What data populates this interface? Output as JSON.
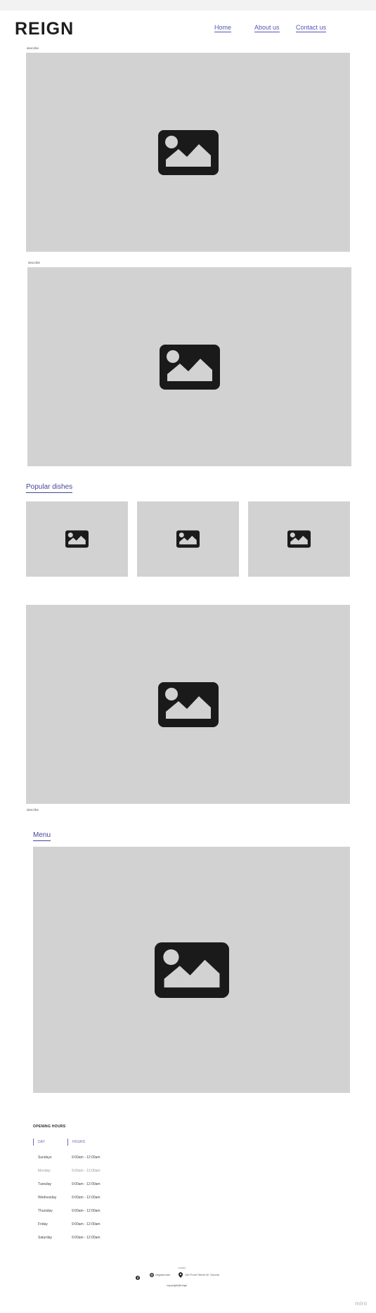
{
  "header": {
    "logo": "REIGN",
    "nav": {
      "home": "Home",
      "about": "About us",
      "contact": "Contact us"
    }
  },
  "captions": {
    "first": "describe",
    "second": "describe",
    "third": "describe"
  },
  "popular": {
    "title": "Popular dishes"
  },
  "menu": {
    "title": "Menu"
  },
  "hours": {
    "title": "OPENING HOURS",
    "col_day": "DAY",
    "col_hours": "HOURS",
    "rows": [
      {
        "day": "Sundays",
        "hours": "9:00am - 12:00am"
      },
      {
        "day": "Monday",
        "hours": "9:00am - 12:00am"
      },
      {
        "day": "Tuesday",
        "hours": "9:00am - 12:00am"
      },
      {
        "day": "Wednesday",
        "hours": "9:00am - 12:00am"
      },
      {
        "day": "Thursday",
        "hours": "9:00am - 12:00am"
      },
      {
        "day": "Friday",
        "hours": "9:00am - 12:00am"
      },
      {
        "day": "Saturday",
        "hours": "9:00am - 12:00am"
      }
    ]
  },
  "footer": {
    "label": "contact",
    "instagram": "reigntoronto",
    "address": "140 Front Street W, Toronto",
    "copyright": "copyright@reign"
  },
  "watermark": "miro",
  "colors": {
    "accent": "#5656b5",
    "placeholder": "#d2d2d2",
    "icon": "#1a1a1a"
  }
}
